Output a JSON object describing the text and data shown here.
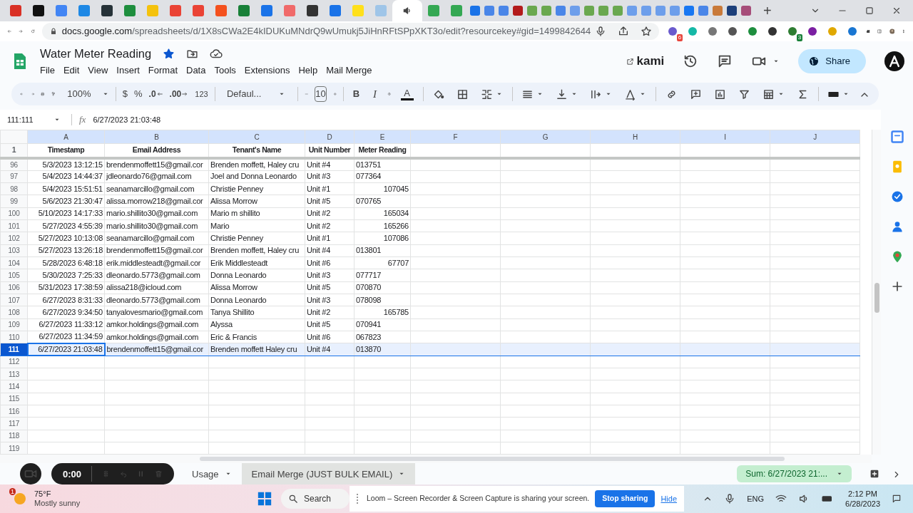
{
  "browser": {
    "tabs": [
      {
        "selected": false
      },
      {
        "selected": false
      },
      {
        "selected": false
      },
      {
        "selected": false
      },
      {
        "selected": false
      },
      {
        "selected": false
      },
      {
        "selected": false
      },
      {
        "selected": false
      },
      {
        "selected": false
      },
      {
        "selected": false
      },
      {
        "selected": false
      },
      {
        "selected": false
      },
      {
        "selected": false
      },
      {
        "selected": false
      },
      {
        "selected": false
      },
      {
        "selected": false
      },
      {
        "selected": false
      },
      {
        "selected": true
      },
      {
        "selected": false
      },
      {
        "selected": false
      },
      {
        "selected": false
      },
      {
        "selected": false
      },
      {
        "selected": false
      },
      {
        "selected": false
      },
      {
        "selected": false
      },
      {
        "selected": false
      },
      {
        "selected": false
      },
      {
        "selected": false
      },
      {
        "selected": false
      },
      {
        "selected": false
      },
      {
        "selected": false
      },
      {
        "selected": false
      },
      {
        "selected": false
      },
      {
        "selected": false
      },
      {
        "selected": false
      },
      {
        "selected": false
      },
      {
        "selected": false
      },
      {
        "selected": false
      },
      {
        "selected": false
      },
      {
        "selected": false
      }
    ],
    "new_tab": "+",
    "url_host": "docs.google.com",
    "url_path": "/spreadsheets/d/1X8sCWa2E4kIDUKuMNdrQ9wUmukj5JiHnRFtSPpXKT3o/edit?resourcekey#gid=1499842644",
    "extension_badges": [
      "6",
      "3"
    ]
  },
  "doc": {
    "title": "Water Meter Reading",
    "starred": true,
    "menu": [
      "File",
      "Edit",
      "View",
      "Insert",
      "Format",
      "Data",
      "Tools",
      "Extensions",
      "Help",
      "Mail Merge"
    ],
    "kami": "kami",
    "share": "Share"
  },
  "toolbar": {
    "zoom": "100%",
    "currency": "$",
    "percent": "%",
    "decrease_decimal": ".0",
    "increase_decimal": ".00",
    "number_format": "123",
    "font": "Defaul...",
    "font_size": "10",
    "bold": "B",
    "italic": "I",
    "text_color": "A"
  },
  "formula_bar": {
    "name_box": "111:111",
    "fx": "fx",
    "value": "6/27/2023 21:03:48"
  },
  "sheet": {
    "columns": [
      "A",
      "B",
      "C",
      "D",
      "E",
      "F",
      "G",
      "H",
      "I",
      "J"
    ],
    "header_row": {
      "row": "1",
      "cells": [
        "Timestamp",
        "Email Address",
        "Tenant's Name",
        "Unit Number",
        "Meter Reading"
      ]
    },
    "rows": [
      {
        "row": "96",
        "timestamp": "5/3/2023 13:12:15",
        "email": "brendenmoffett15@gmail.cor",
        "tenant": "Brenden moffett, Haley cru",
        "unit": "Unit #4",
        "reading": "013751",
        "kind": "text",
        "selected": false
      },
      {
        "row": "97",
        "timestamp": "5/4/2023 14:44:37",
        "email": "jdleonardo76@gmail.com",
        "tenant": "Joel and Donna Leonardo",
        "unit": "Unit #3",
        "reading": "077364",
        "kind": "text",
        "selected": false
      },
      {
        "row": "98",
        "timestamp": "5/4/2023 15:51:51",
        "email": "seanamarcillo@gmail.com",
        "tenant": "Christie Penney",
        "unit": "Unit #1",
        "reading": "107045",
        "kind": "number",
        "selected": false
      },
      {
        "row": "99",
        "timestamp": "5/6/2023 21:30:47",
        "email": "alissa.morrow218@gmail.cor",
        "tenant": "Alissa Morrow",
        "unit": "Unit #5",
        "reading": "070765",
        "kind": "text",
        "selected": false
      },
      {
        "row": "100",
        "timestamp": "5/10/2023 14:17:33",
        "email": "mario.shillito30@gmail.com",
        "tenant": "Mario m shillito",
        "unit": "Unit #2",
        "reading": "165034",
        "kind": "number",
        "selected": false
      },
      {
        "row": "101",
        "timestamp": "5/27/2023 4:55:39",
        "email": "mario.shillito30@gmail.com",
        "tenant": "Mario",
        "unit": "Unit #2",
        "reading": "165266",
        "kind": "number",
        "selected": false
      },
      {
        "row": "102",
        "timestamp": "5/27/2023 10:13:08",
        "email": "seanamarcillo@gmail.com",
        "tenant": "Christie Penney",
        "unit": "Unit #1",
        "reading": "107086",
        "kind": "number",
        "selected": false
      },
      {
        "row": "103",
        "timestamp": "5/27/2023 13:26:18",
        "email": "brendenmoffett15@gmail.cor",
        "tenant": "Brenden moffett, Haley cru",
        "unit": "Unit #4",
        "reading": "013801",
        "kind": "text",
        "selected": false
      },
      {
        "row": "104",
        "timestamp": "5/28/2023 6:48:18",
        "email": "erik.middlesteadt@gmail.cor",
        "tenant": "Erik Middlesteadt",
        "unit": "Unit #6",
        "reading": "67707",
        "kind": "number",
        "selected": false
      },
      {
        "row": "105",
        "timestamp": "5/30/2023 7:25:33",
        "email": "dleonardo.5773@gmail.com",
        "tenant": "Donna Leonardo",
        "unit": "Unit #3",
        "reading": "077717",
        "kind": "text",
        "selected": false
      },
      {
        "row": "106",
        "timestamp": "5/31/2023 17:38:59",
        "email": "alissa218@icloud.com",
        "tenant": "Alissa Morrow",
        "unit": "Unit #5",
        "reading": "070870",
        "kind": "text",
        "selected": false
      },
      {
        "row": "107",
        "timestamp": "6/27/2023 8:31:33",
        "email": "dleonardo.5773@gmail.com",
        "tenant": "Donna Leonardo",
        "unit": "Unit #3",
        "reading": "078098",
        "kind": "text",
        "selected": false
      },
      {
        "row": "108",
        "timestamp": "6/27/2023 9:34:50",
        "email": "tanyalovesmario@gmail.com",
        "tenant": "Tanya Shillito",
        "unit": "Unit #2",
        "reading": "165785",
        "kind": "number",
        "selected": false
      },
      {
        "row": "109",
        "timestamp": "6/27/2023 11:33:12",
        "email": "amkor.holdings@gmail.com",
        "tenant": "Alyssa",
        "unit": "Unit #5",
        "reading": "070941",
        "kind": "text",
        "selected": false
      },
      {
        "row": "110",
        "timestamp": "6/27/2023 11:34:59",
        "email": "amkor.holdings@gmail.com",
        "tenant": "Eric & Francis",
        "unit": "Unit #6",
        "reading": "067823",
        "kind": "text",
        "selected": false
      },
      {
        "row": "111",
        "timestamp": "6/27/2023 21:03:48",
        "email": "brendenmoffett15@gmail.cor",
        "tenant": "Brenden moffett Haley cru",
        "unit": "Unit #4",
        "reading": "013870",
        "kind": "text",
        "selected": true
      }
    ],
    "empty_rows": [
      "112",
      "113",
      "114",
      "115",
      "116",
      "117",
      "118",
      "119"
    ]
  },
  "sheet_tabs": [
    {
      "label": "Usage",
      "highlighted": false
    },
    {
      "label": "Email Merge (JUST BULK EMAIL)",
      "highlighted": true
    }
  ],
  "sum": "Sum: 6/27/2023 21:...",
  "recorder": {
    "time": "0:00"
  },
  "taskbar": {
    "weather_badge": "1",
    "temperature": "75°F",
    "weather": "Mostly sunny",
    "search": "Search",
    "sharing_notice": "Loom – Screen Recorder & Screen Capture is sharing your screen.",
    "stop_sharing": "Stop sharing",
    "hide": "Hide",
    "language": "ENG",
    "time": "2:12 PM",
    "date": "6/28/2023"
  }
}
